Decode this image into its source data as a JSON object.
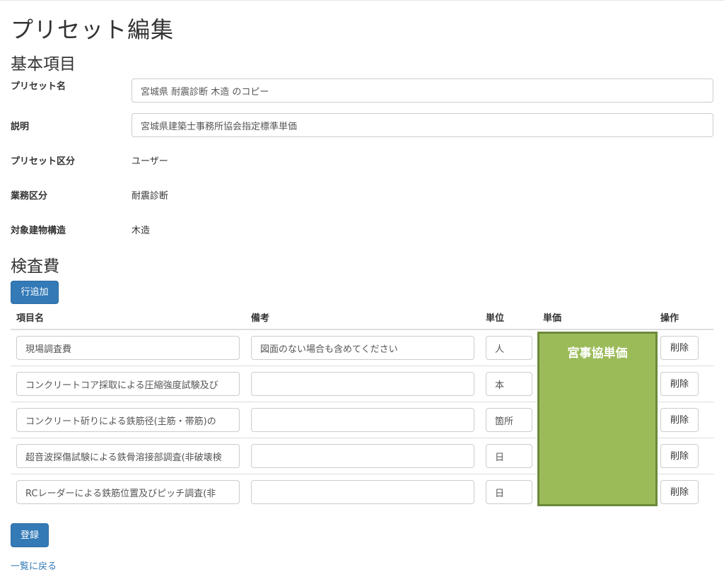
{
  "page_title": "プリセット編集",
  "basic_section": {
    "title": "基本項目",
    "preset_name_label": "プリセット名",
    "preset_name_value": "宮城県 耐震診断 木造 のコピー",
    "description_label": "説明",
    "description_value": "宮城県建築士事務所協会指定標準単価",
    "preset_type_label": "プリセット区分",
    "preset_type_value": "ユーザー",
    "business_type_label": "業務区分",
    "business_type_value": "耐震診断",
    "structure_label": "対象建物構造",
    "structure_value": "木造"
  },
  "inspection_section": {
    "title": "検査費",
    "add_row_label": "行追加",
    "columns": [
      "項目名",
      "備考",
      "単位",
      "単価",
      "操作"
    ],
    "rows": [
      {
        "name": "現場調査費",
        "note": "図面のない場合も含めてください",
        "unit": "人",
        "delete": "削除"
      },
      {
        "name": "コンクリートコア採取による圧縮強度試験及び",
        "note": "",
        "unit": "本",
        "delete": "削除"
      },
      {
        "name": "コンクリート斫りによる鉄筋径(主筋・帯筋)の",
        "note": "",
        "unit": "箇所",
        "delete": "削除"
      },
      {
        "name": "超音波探傷試験による鉄骨溶接部調査(非破壊検",
        "note": "",
        "unit": "日",
        "delete": "削除"
      },
      {
        "name": "RCレーダーによる鉄筋位置及びピッチ調査(非",
        "note": "",
        "unit": "日",
        "delete": "削除"
      }
    ],
    "price_overlay_label": "宮事協単価",
    "overlay_color": "#9bbb59"
  },
  "submit_label": "登録",
  "back_link_label": "一覧に戻る"
}
